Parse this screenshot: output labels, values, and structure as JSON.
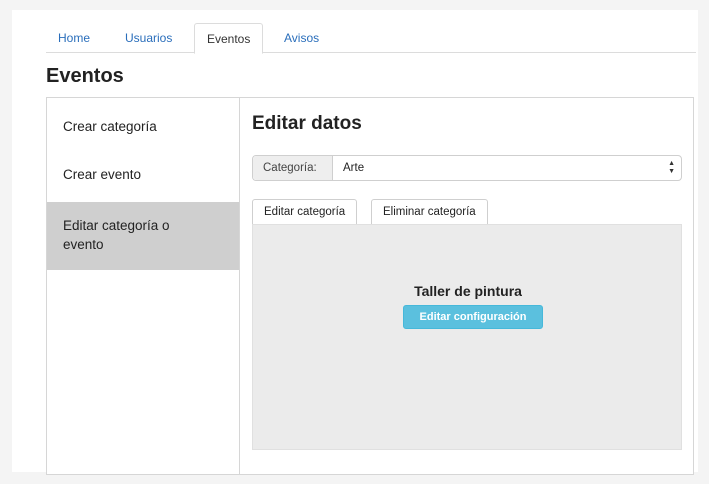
{
  "nav": {
    "tabs": [
      {
        "label": "Home"
      },
      {
        "label": "Usuarios"
      },
      {
        "label": "Eventos"
      },
      {
        "label": "Avisos"
      }
    ],
    "active_index": 2
  },
  "page": {
    "title": "Eventos"
  },
  "sidebar": {
    "items": [
      {
        "label": "Crear categoría"
      },
      {
        "label": "Crear evento"
      },
      {
        "label": "Editar categoría o evento"
      }
    ],
    "active_index": 2
  },
  "main": {
    "title": "Editar datos",
    "category_select": {
      "addon_label": "Categoría:",
      "value": "Arte"
    },
    "tabs": [
      {
        "label": "Editar categoría"
      },
      {
        "label": "Eliminar categoría"
      }
    ],
    "card": {
      "title": "Taller de pintura",
      "button_label": "Editar configuración"
    }
  },
  "colors": {
    "link": "#2a6ebb",
    "sidebar_active": "#cfcfcf",
    "info_button": "#5bc0de",
    "pane_background": "#ebebeb"
  }
}
